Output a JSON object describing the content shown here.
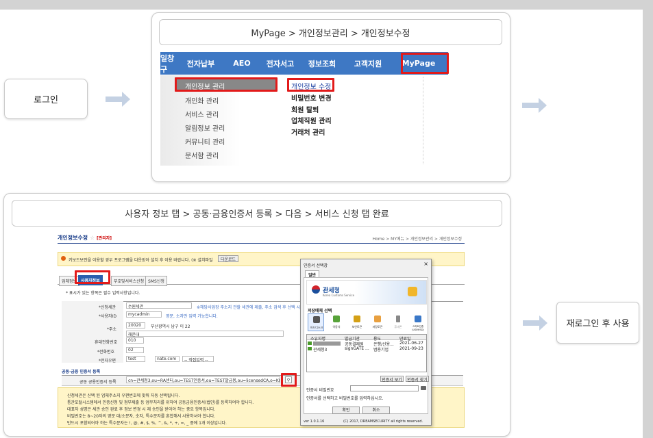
{
  "steps": {
    "login": "로그인",
    "relogin": "재로그인 후 사용"
  },
  "top": {
    "breadcrumb": "MyPage > 개인정보관리 > 개인정보수정",
    "nav": [
      "일창구",
      "전자납부",
      "AEO",
      "전자서고",
      "정보조회",
      "고객지원",
      "MyPage"
    ],
    "menu_left": [
      "개인정보 관리",
      "개인화 관리",
      "서비스 관리",
      "알림정보 관리",
      "커뮤니티 관리",
      "문서함 관리"
    ],
    "menu_right": [
      "개인정보 수정",
      "비밀번호 변경",
      "회원 탈퇴",
      "업체직원 관리",
      "거래처 관리"
    ]
  },
  "bottom": {
    "breadcrumb": "사용자 정보 탭 > 공동·금융인증서 등록 > 다음 > 서비스 신청 탭 완료",
    "page_title": "개인정보수정",
    "admin_tag": "[관리자]",
    "path": "Home > MY메뉴 > 개인정보관리 > 개인정보수정",
    "notice": "키보드보안을 이용할 경우 프로그램을 다운받아 설치 후 이용 바랍니다. (※ 설치파일",
    "notice_btn": "다운로드",
    "tabs": [
      "업체정보",
      "사용자정보",
      "부호및서비스신청",
      "SMS신청"
    ],
    "required_note": "* 표시가 있는 항목은 필수 입력사항입니다.",
    "rows": [
      {
        "label": "*신청세관",
        "value": "수원세관",
        "hint": "※해당사업장 주소지 관할 세관에 제출, 주소 검색 후 선택 시"
      },
      {
        "label": "*사용자ID",
        "value": "mycadmin",
        "hint": "영문, 소자만 입력 가능합니다."
      },
      {
        "label": "*주소",
        "value": "20020",
        "hint": "부산광역시 남구 이 22"
      },
      {
        "label": "",
        "value": "해운대",
        "hint": ""
      },
      {
        "label": "휴대전화번호",
        "value": "010",
        "hint": ""
      },
      {
        "label": "*전화번호",
        "value": "02",
        "hint": ""
      },
      {
        "label": "*전자우편",
        "value": "test",
        "hint": "nate.com"
      }
    ],
    "select_direct": "-- 직접입력 --",
    "cert_section": "공동·금융 인증서 등록",
    "cert_label": "공동 공용인증서 등록",
    "cert_value": "cn=관세청3,ou=RA센터,ou=TEST인증서,ou=TEST발급용,ou=licensedCA,o=KICA,c=KR",
    "bullets": [
      "신청세관은 신택 된 업체주소지 우편번호에 맞춰 자동 선택됩니다.",
      "통관포털시스템에서 인증신청 및 첨부제출 등 업무처리를 위하여 공동금융인증서(법인)를 등록하여야 합니다.",
      "대표자 성명은 세관 승인 완료 후 정보 변경 시 재 승인을 받아야 하는 중요 항목입니다.",
      "비밀번호는 8~20자의 영문 대/소문자, 숫자, 특수문자를 혼합해서 사용하셔야 합니다.",
      "반드시 포함되어야 하는 특수문자는 !, @, #, $, %, ^, &, *, +, =, _ 중에 1개 이상입니다."
    ]
  },
  "dialog": {
    "title": "인증서 선택창",
    "tab": "일반",
    "brand": "관세청",
    "brand_sub": "Korea Customs Service",
    "storage_label": "저장매체 선택",
    "storage": [
      "하드디스크",
      "이동식",
      "보안토큰",
      "저장토큰",
      "휴대폰",
      "스마트인증(USIM/SD)"
    ],
    "columns": [
      "소유자명",
      "발급기관",
      "용도",
      "만료일"
    ],
    "rows": [
      [
        "",
        "공동결제원",
        "은행/신용...",
        "2021-06-27"
      ],
      [
        "관세청3",
        "signGATE ...",
        "범용기업",
        "2021-09-23"
      ]
    ],
    "btn_view": "인증서 보기",
    "btn_find": "인증서 찾기",
    "pw_label": "인증서 비밀번호",
    "pw_hint": "인증서를 선택하고 비밀번호를 입력하십시오.",
    "ok": "확인",
    "cancel": "취소",
    "version": "ver 1.0.1.16",
    "copyright": "(C) 2017, DREAMSECURITY all rights reserved."
  }
}
